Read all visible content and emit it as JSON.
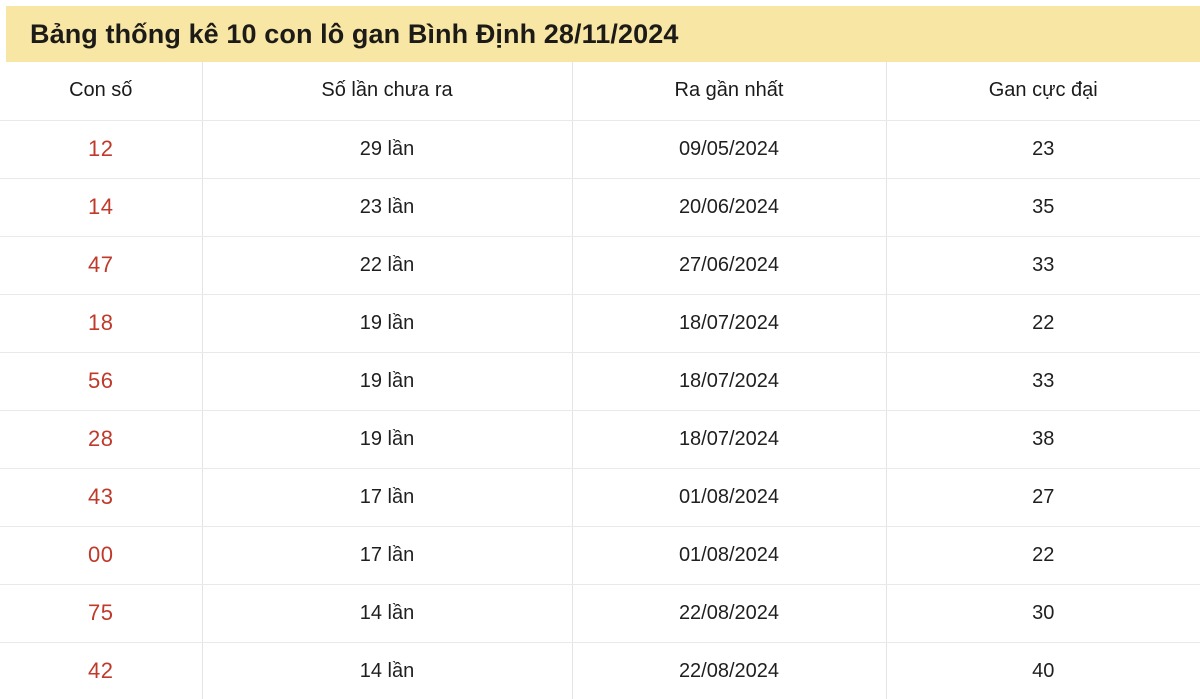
{
  "banner": {
    "title": "Bảng thống kê 10 con lô gan Bình Định 28/11/2024",
    "background_color": "#f8e6a4",
    "text_color": "#1c1b18"
  },
  "table": {
    "accent_number_color": "#c0392b",
    "headers": [
      "Con số",
      "Số lần chưa ra",
      "Ra gần nhất",
      "Gan cực đại"
    ],
    "rows": [
      {
        "number": "12",
        "times_missing": "29 lần",
        "last_appeared": "09/05/2024",
        "max_gan": "23"
      },
      {
        "number": "14",
        "times_missing": "23 lần",
        "last_appeared": "20/06/2024",
        "max_gan": "35"
      },
      {
        "number": "47",
        "times_missing": "22 lần",
        "last_appeared": "27/06/2024",
        "max_gan": "33"
      },
      {
        "number": "18",
        "times_missing": "19 lần",
        "last_appeared": "18/07/2024",
        "max_gan": "22"
      },
      {
        "number": "56",
        "times_missing": "19 lần",
        "last_appeared": "18/07/2024",
        "max_gan": "33"
      },
      {
        "number": "28",
        "times_missing": "19 lần",
        "last_appeared": "18/07/2024",
        "max_gan": "38"
      },
      {
        "number": "43",
        "times_missing": "17 lần",
        "last_appeared": "01/08/2024",
        "max_gan": "27"
      },
      {
        "number": "00",
        "times_missing": "17 lần",
        "last_appeared": "01/08/2024",
        "max_gan": "22"
      },
      {
        "number": "75",
        "times_missing": "14 lần",
        "last_appeared": "22/08/2024",
        "max_gan": "30"
      },
      {
        "number": "42",
        "times_missing": "14 lần",
        "last_appeared": "22/08/2024",
        "max_gan": "40"
      }
    ]
  }
}
